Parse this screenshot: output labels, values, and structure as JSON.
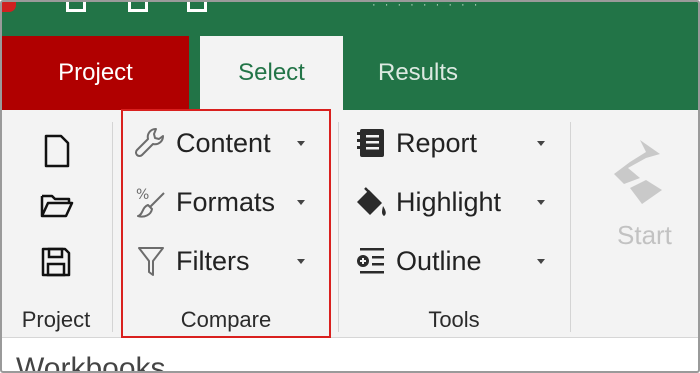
{
  "window": {
    "title_partial": "· · · · · · · · ·"
  },
  "tabs": [
    {
      "label": "Project"
    },
    {
      "label": "Select"
    },
    {
      "label": "Results"
    }
  ],
  "ribbon": {
    "project_group": {
      "label": "Project"
    },
    "compare_group": {
      "label": "Compare",
      "commands": [
        {
          "label": "Content",
          "icon": "wrench-icon"
        },
        {
          "label": "Formats",
          "icon": "brush-icon"
        },
        {
          "label": "Filters",
          "icon": "filter-icon"
        }
      ]
    },
    "tools_group": {
      "label": "Tools",
      "commands": [
        {
          "label": "Report",
          "icon": "report-icon"
        },
        {
          "label": "Highlight",
          "icon": "paint-bucket-icon"
        },
        {
          "label": "Outline",
          "icon": "outline-icon"
        }
      ]
    },
    "start": {
      "label": "Start"
    }
  },
  "content": {
    "title": "Workbooks"
  },
  "colors": {
    "brand_green": "#227447",
    "project_tab_red": "#b00000",
    "highlight_box": "#d9201e"
  }
}
